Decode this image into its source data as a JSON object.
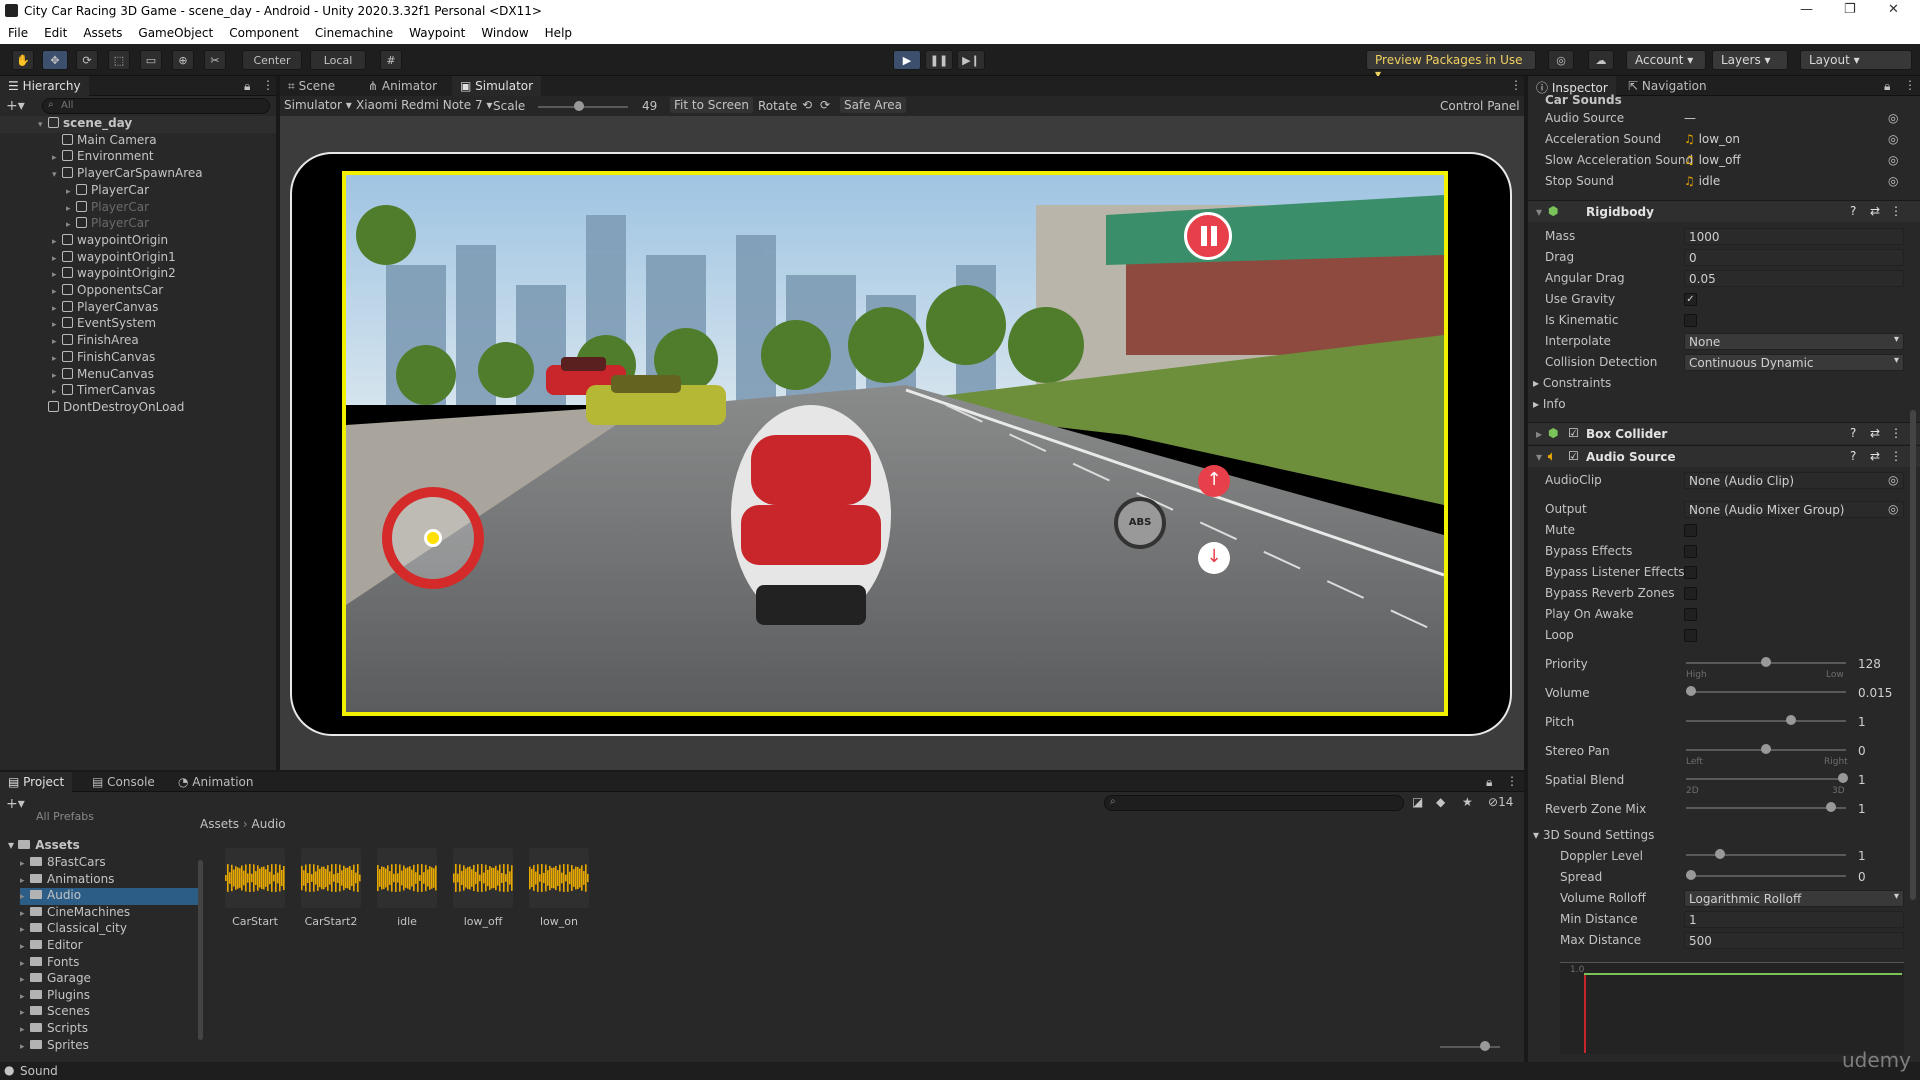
{
  "window": {
    "title": "City Car Racing 3D Game - scene_day - Android - Unity 2020.3.32f1 Personal <DX11>"
  },
  "menu": [
    "File",
    "Edit",
    "Assets",
    "GameObject",
    "Component",
    "Cinemachine",
    "Waypoint",
    "Window",
    "Help"
  ],
  "toolbar": {
    "center_label": "Center",
    "local_label": "Local",
    "preview_packages": "Preview Packages in Use",
    "account": "Account",
    "layers": "Layers",
    "layout": "Layout"
  },
  "hierarchy": {
    "tab": "Hierarchy",
    "search_placeholder": "All",
    "items": [
      {
        "label": "scene_day",
        "depth": 0,
        "bold": true
      },
      {
        "label": "Main Camera",
        "depth": 1
      },
      {
        "label": "Environment",
        "depth": 1
      },
      {
        "label": "PlayerCarSpawnArea",
        "depth": 1
      },
      {
        "label": "PlayerCar",
        "depth": 2
      },
      {
        "label": "PlayerCar",
        "depth": 2,
        "dim": true
      },
      {
        "label": "PlayerCar",
        "depth": 2,
        "dim": true
      },
      {
        "label": "waypointOrigin",
        "depth": 1
      },
      {
        "label": "waypointOrigin1",
        "depth": 1
      },
      {
        "label": "waypointOrigin2",
        "depth": 1
      },
      {
        "label": "OpponentsCar",
        "depth": 1
      },
      {
        "label": "PlayerCanvas",
        "depth": 1
      },
      {
        "label": "EventSystem",
        "depth": 1
      },
      {
        "label": "FinishArea",
        "depth": 1
      },
      {
        "label": "FinishCanvas",
        "depth": 1
      },
      {
        "label": "MenuCanvas",
        "depth": 1
      },
      {
        "label": "TimerCanvas",
        "depth": 1
      },
      {
        "label": "DontDestroyOnLoad",
        "depth": 0
      }
    ]
  },
  "scene_tabs": [
    "Scene",
    "Animator",
    "Simulator"
  ],
  "simulator": {
    "mode": "Simulator",
    "device": "Xiaomi Redmi Note 7",
    "scale_label": "Scale",
    "scale_value": "49",
    "fit_to_screen": "Fit to Screen",
    "rotate": "Rotate",
    "safe_area": "Safe Area",
    "control_panel": "Control Panel"
  },
  "inspector": {
    "tabs": [
      "Inspector",
      "Navigation"
    ],
    "car_sounds": {
      "header": "Car Sounds",
      "audio_source": "Audio Source",
      "audio_source_val": "—",
      "accel_label": "Acceleration Sound",
      "accel_val": "low_on",
      "slow_label": "Slow Acceleration Sound",
      "slow_val": "low_off",
      "stop_label": "Stop Sound",
      "stop_val": "idle"
    },
    "rigidbody": {
      "header": "Rigidbody",
      "mass_label": "Mass",
      "mass": "1000",
      "drag_label": "Drag",
      "drag": "0",
      "angdrag_label": "Angular Drag",
      "angdrag": "0.05",
      "gravity_label": "Use Gravity",
      "kinematic_label": "Is Kinematic",
      "interp_label": "Interpolate",
      "interp": "None",
      "collision_label": "Collision Detection",
      "collision": "Continuous Dynamic",
      "constraints": "Constraints",
      "info": "Info"
    },
    "box_collider": "Box Collider",
    "audio_source": {
      "header": "Audio Source",
      "clip_label": "AudioClip",
      "clip": "None (Audio Clip)",
      "output_label": "Output",
      "output": "None (Audio Mixer Group)",
      "mute": "Mute",
      "bypass_effects": "Bypass Effects",
      "bypass_listener": "Bypass Listener Effects",
      "bypass_reverb": "Bypass Reverb Zones",
      "play_on_awake": "Play On Awake",
      "loop": "Loop",
      "priority_label": "Priority",
      "priority": "128",
      "priority_high": "High",
      "priority_low": "Low",
      "volume_label": "Volume",
      "volume": "0.015",
      "pitch_label": "Pitch",
      "pitch": "1",
      "stereo_label": "Stereo Pan",
      "stereo": "0",
      "stereo_left": "Left",
      "stereo_right": "Right",
      "spatial_label": "Spatial Blend",
      "spatial": "1",
      "spatial_2d": "2D",
      "spatial_3d": "3D",
      "reverb_label": "Reverb Zone Mix",
      "reverb": "1",
      "sound3d_header": "3D Sound Settings",
      "doppler_label": "Doppler Level",
      "doppler": "1",
      "spread_label": "Spread",
      "spread": "0",
      "rolloff_label": "Volume Rolloff",
      "rolloff": "Logarithmic Rolloff",
      "min_label": "Min Distance",
      "min": "1",
      "max_label": "Max Distance",
      "max": "500",
      "graph_tick": "1.0"
    }
  },
  "bottom_tabs": [
    "Project",
    "Console",
    "Animation"
  ],
  "project": {
    "breadcrumb": [
      "Assets",
      "Audio"
    ],
    "count": "14",
    "tree_root": "Assets",
    "tree_top": "All Prefabs",
    "folders": [
      "8FastCars",
      "Animations",
      "Audio",
      "CineMachines",
      "Classical_city",
      "Editor",
      "Fonts",
      "Garage",
      "Plugins",
      "Scenes",
      "Scripts",
      "Sprites"
    ],
    "assets": [
      "CarStart",
      "CarStart2",
      "idle",
      "low_off",
      "low_on"
    ]
  },
  "status": {
    "text": "Sound",
    "watermark": "udemy"
  },
  "colors": {
    "accent": "#3c4f6c",
    "game_border": "#f0f000",
    "audio_wave": "#e8a800"
  }
}
